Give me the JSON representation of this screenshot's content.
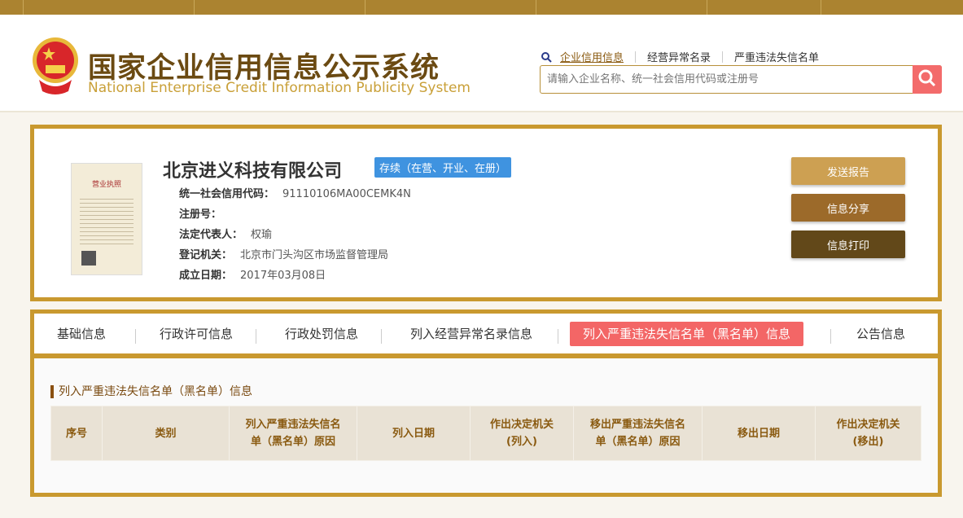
{
  "header": {
    "title_cn": "国家企业信用信息公示系统",
    "title_en": "National Enterprise Credit Information Publicity System",
    "links": [
      "企业信用信息",
      "经营异常名录",
      "严重违法失信名单"
    ],
    "search_placeholder": "请输入企业名称、统一社会信用代码或注册号"
  },
  "company": {
    "name": "北京进义科技有限公司",
    "status": "存续（在营、开业、在册）",
    "fields": [
      {
        "label": "统一社会信用代码：",
        "value": "91110106MA00CEMK4N"
      },
      {
        "label": "注册号：",
        "value": ""
      },
      {
        "label": "法定代表人：",
        "value": "权瑜"
      },
      {
        "label": "登记机关：",
        "value": "北京市门头沟区市场监督管理局"
      },
      {
        "label": "成立日期：",
        "value": "2017年03月08日"
      }
    ],
    "license_title": "营业执照"
  },
  "actions": {
    "send": "发送报告",
    "share": "信息分享",
    "print": "信息打印"
  },
  "colors": {
    "send": "#cda052",
    "share": "#9c6a2a",
    "print": "#624819",
    "accent": "#c9992f",
    "active_tab": "#f36666"
  },
  "tabs": [
    "基础信息",
    "行政许可信息",
    "行政处罚信息",
    "列入经营异常名录信息",
    "列入严重违法失信名单（黑名单）信息",
    "公告信息"
  ],
  "section": {
    "title": "列入严重违法失信名单（黑名单）信息",
    "columns": [
      "序号",
      "类别",
      "列入严重违法失信名单（黑名单）原因",
      "列入日期",
      "作出决定机关(列入)",
      "移出严重违法失信名单（黑名单）原因",
      "移出日期",
      "作出决定机关(移出)"
    ]
  }
}
